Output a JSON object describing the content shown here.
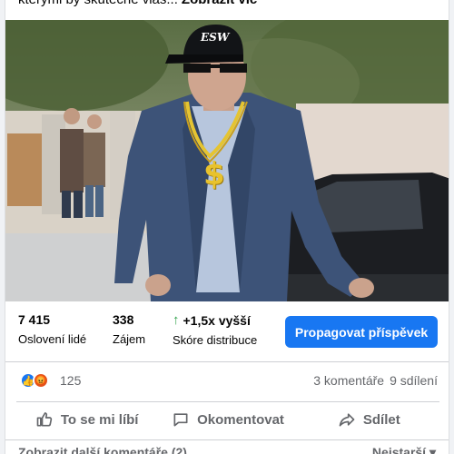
{
  "post": {
    "text": "kterými by skutečně vlas...",
    "see_more": "Zobrazit víc"
  },
  "photo": {
    "cap_text": "ESW",
    "chain_symbol": "$"
  },
  "stats": [
    {
      "value": "7 415",
      "label": "Oslovení lidé"
    },
    {
      "value": "338",
      "label": "Zájem"
    },
    {
      "value": "+1,5x vyšší",
      "label": "Skóre distribuce",
      "trend": "up",
      "trend_color": "#31a24c"
    }
  ],
  "promote_label": "Propagovat příspěvek",
  "reactions": {
    "icons": [
      "like-icon",
      "angry-icon"
    ],
    "count": "125",
    "comments": "3 komentáře",
    "shares": "9 sdílení"
  },
  "actions": {
    "like": "To se mi líbí",
    "comment": "Okomentovat",
    "share": "Sdílet"
  },
  "comments_footer": {
    "more": "Zobrazit další komentáře (2)",
    "sort": "Nejstarší"
  },
  "colors": {
    "accent": "#1877f2",
    "muted": "#65676b",
    "divider": "#ced0d4"
  }
}
